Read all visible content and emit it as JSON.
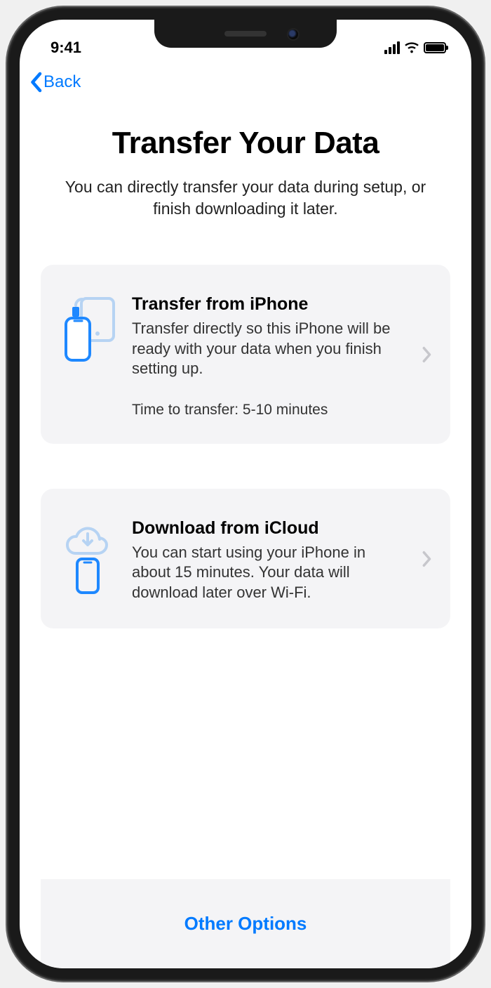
{
  "statusbar": {
    "time": "9:41"
  },
  "nav": {
    "back_label": "Back"
  },
  "header": {
    "title": "Transfer Your Data",
    "subtitle": "You can directly transfer your data during setup, or finish downloading it later."
  },
  "options": {
    "transfer": {
      "title": "Transfer from iPhone",
      "description": "Transfer directly so this iPhone will be ready with your data when you finish setting up.",
      "meta": "Time to transfer: 5-10 minutes"
    },
    "icloud": {
      "title": "Download from iCloud",
      "description": "You can start using your iPhone in about 15 minutes. Your data will download later over Wi-Fi."
    }
  },
  "footer": {
    "other_options": "Other Options"
  }
}
